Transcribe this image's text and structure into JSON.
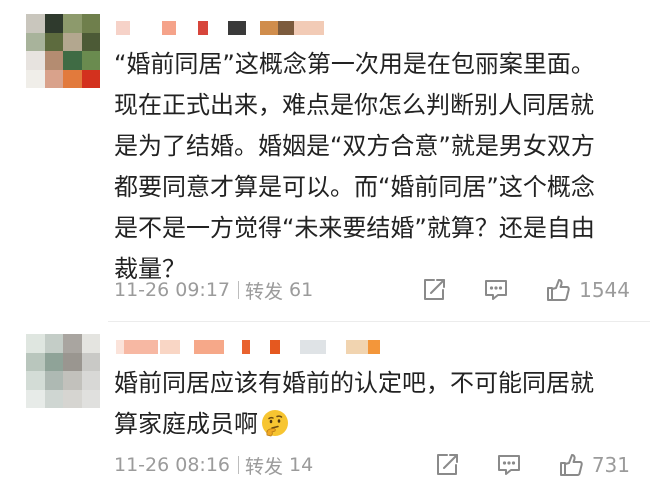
{
  "comments": [
    {
      "content_lines": [
        "“婚前同居”这概念第一次用是在包丽案里面。",
        "现在正式出来，难点是你怎么判断别人同居就",
        "是为了结婚。婚姻是“双方合意”就是男女双方",
        "都要同意才算是可以。而“婚前同居”这个概念",
        "是不是一方觉得“未来要结婚”就算？还是自由",
        "裁量？"
      ],
      "timestamp": "11-26 09:17",
      "repost_label": "转发",
      "repost_count": "61",
      "like_count": "1544",
      "icons": [
        "share-icon",
        "reply-icon",
        "like-icon"
      ]
    },
    {
      "content_lines": [
        "婚前同居应该有婚前的认定吧，不可能同居就",
        "算家庭成员啊"
      ],
      "emoji": "thinking-face-emoji",
      "timestamp": "11-26 08:16",
      "repost_label": "转发",
      "repost_count": "14",
      "like_count": "731",
      "icons": [
        "share-icon",
        "reply-icon",
        "like-icon"
      ]
    }
  ],
  "colors": {
    "text": "#222222",
    "meta": "#9b9b9b",
    "icon": "#8a8a8a",
    "divider": "#ececec"
  }
}
